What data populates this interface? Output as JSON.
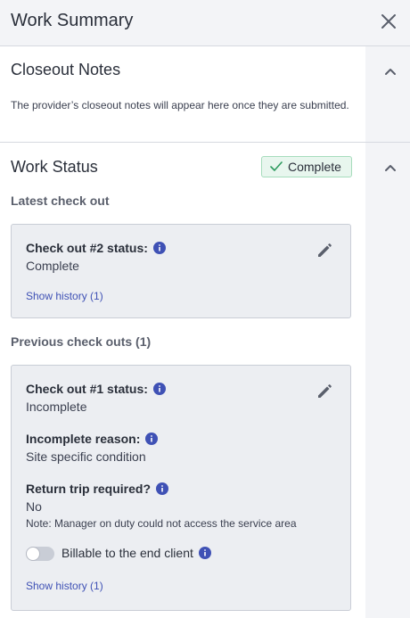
{
  "header": {
    "title": "Work Summary"
  },
  "closeout": {
    "title": "Closeout Notes",
    "text": "The provider’s closeout notes will appear here once they are submitted."
  },
  "work_status": {
    "title": "Work Status",
    "badge": "Complete",
    "latest_label": "Latest check out",
    "previous_label": "Previous check outs (1)",
    "latest_card": {
      "status_label": "Check out #2 status:",
      "status_value": "Complete",
      "history_link": "Show history (1)"
    },
    "previous_card": {
      "status_label": "Check out #1 status:",
      "status_value": "Incomplete",
      "reason_label": "Incomplete reason:",
      "reason_value": "Site specific condition",
      "return_label": "Return trip required?",
      "return_value": "No",
      "return_note": "Note: Manager on duty could not access the service area",
      "billable_label": "Billable to the end client",
      "billable_on": false,
      "history_link": "Show history (1)"
    }
  },
  "colors": {
    "accent": "#3f51b5",
    "success_bg": "#e8f6ee",
    "success_border": "#a6dcbc",
    "success_check": "#2e9b5f"
  }
}
